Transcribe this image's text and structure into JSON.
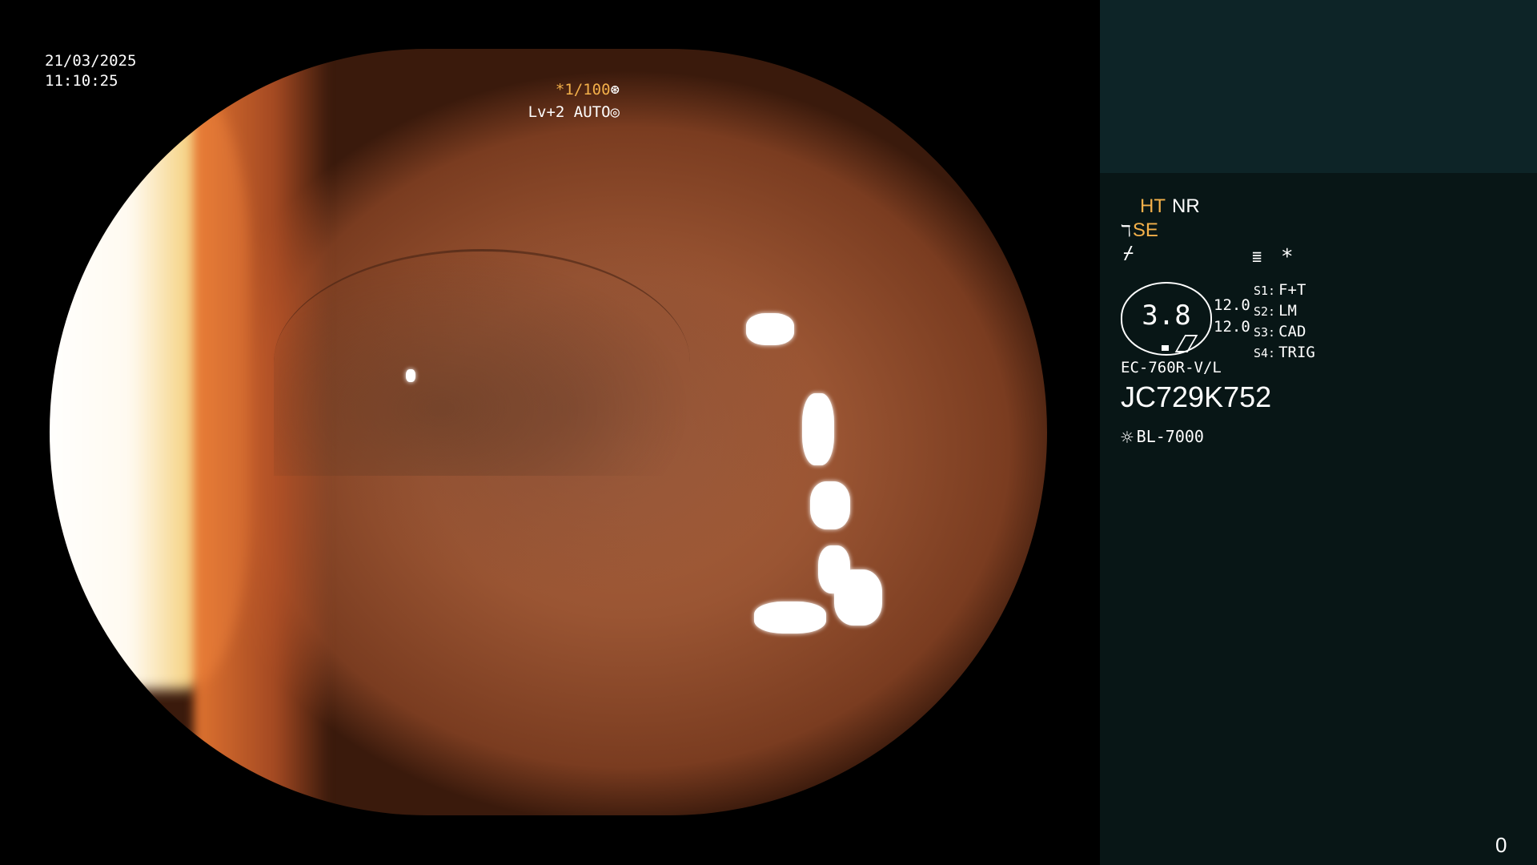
{
  "overlay": {
    "date": "21/03/2025",
    "time": "11:10:25",
    "shutter": "*1/100",
    "shutter_icon": "⊛",
    "iris": "Lv+2 AUTO",
    "iris_icon": "◎"
  },
  "panel": {
    "ht": "HT",
    "nr": "NR",
    "se_icon": "ℸ",
    "se": "SE",
    "line_icon": "⌿",
    "menu_icon": "≣",
    "star": "*",
    "gauge_value": "3.8",
    "gauge_top": "12.0",
    "gauge_bottom": "12.0",
    "switches": [
      {
        "key": "S1:",
        "value": "F+T"
      },
      {
        "key": "S2:",
        "value": "LM"
      },
      {
        "key": "S3:",
        "value": "CAD"
      },
      {
        "key": "S4:",
        "value": "TRIG"
      }
    ],
    "scope_model": "EC-760R-V/L",
    "serial": "JC729K752",
    "light_icon": "☼",
    "light_source": "BL-7000",
    "counter": "0"
  },
  "colors": {
    "accent_orange": "#f3b04a",
    "panel_bg": "#081616",
    "patient_box": "#0d2427"
  }
}
